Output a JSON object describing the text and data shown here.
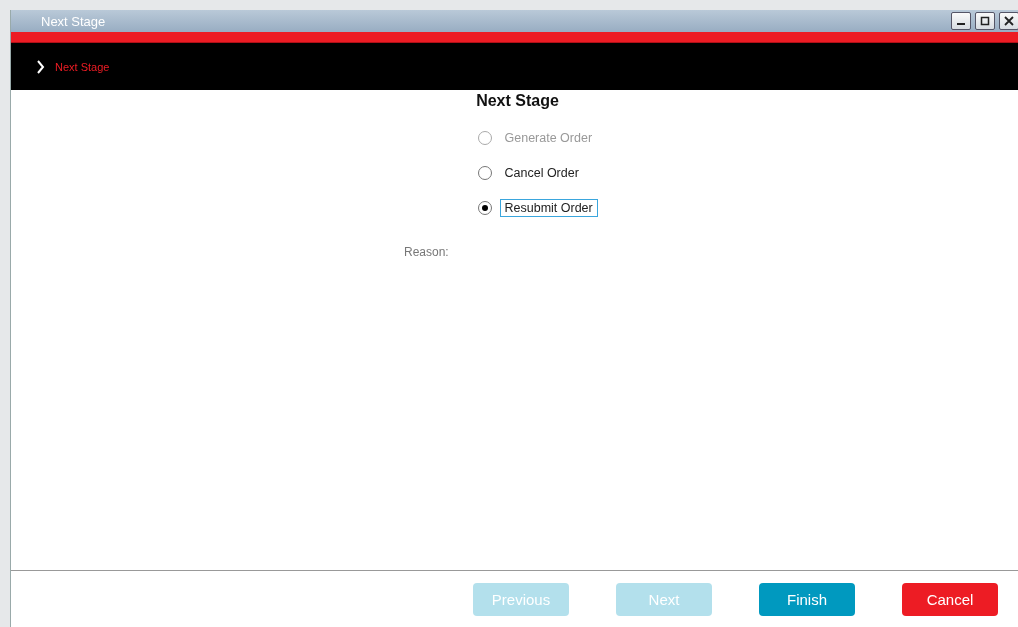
{
  "window": {
    "title": "Next Stage"
  },
  "breadcrumb": {
    "label": "Next Stage"
  },
  "heading": "Next Stage",
  "options": [
    {
      "label": "Generate Order",
      "selected": false,
      "disabled": true,
      "focused": false
    },
    {
      "label": "Cancel Order",
      "selected": false,
      "disabled": false,
      "focused": false
    },
    {
      "label": "Resubmit Order",
      "selected": true,
      "disabled": false,
      "focused": true
    }
  ],
  "reason_label": "Reason:",
  "buttons": [
    {
      "label": "Previous",
      "kind": "secondary",
      "disabled": true
    },
    {
      "label": "Next",
      "kind": "secondary",
      "disabled": true
    },
    {
      "label": "Finish",
      "kind": "primary",
      "disabled": false
    },
    {
      "label": "Cancel",
      "kind": "danger",
      "disabled": false
    }
  ]
}
